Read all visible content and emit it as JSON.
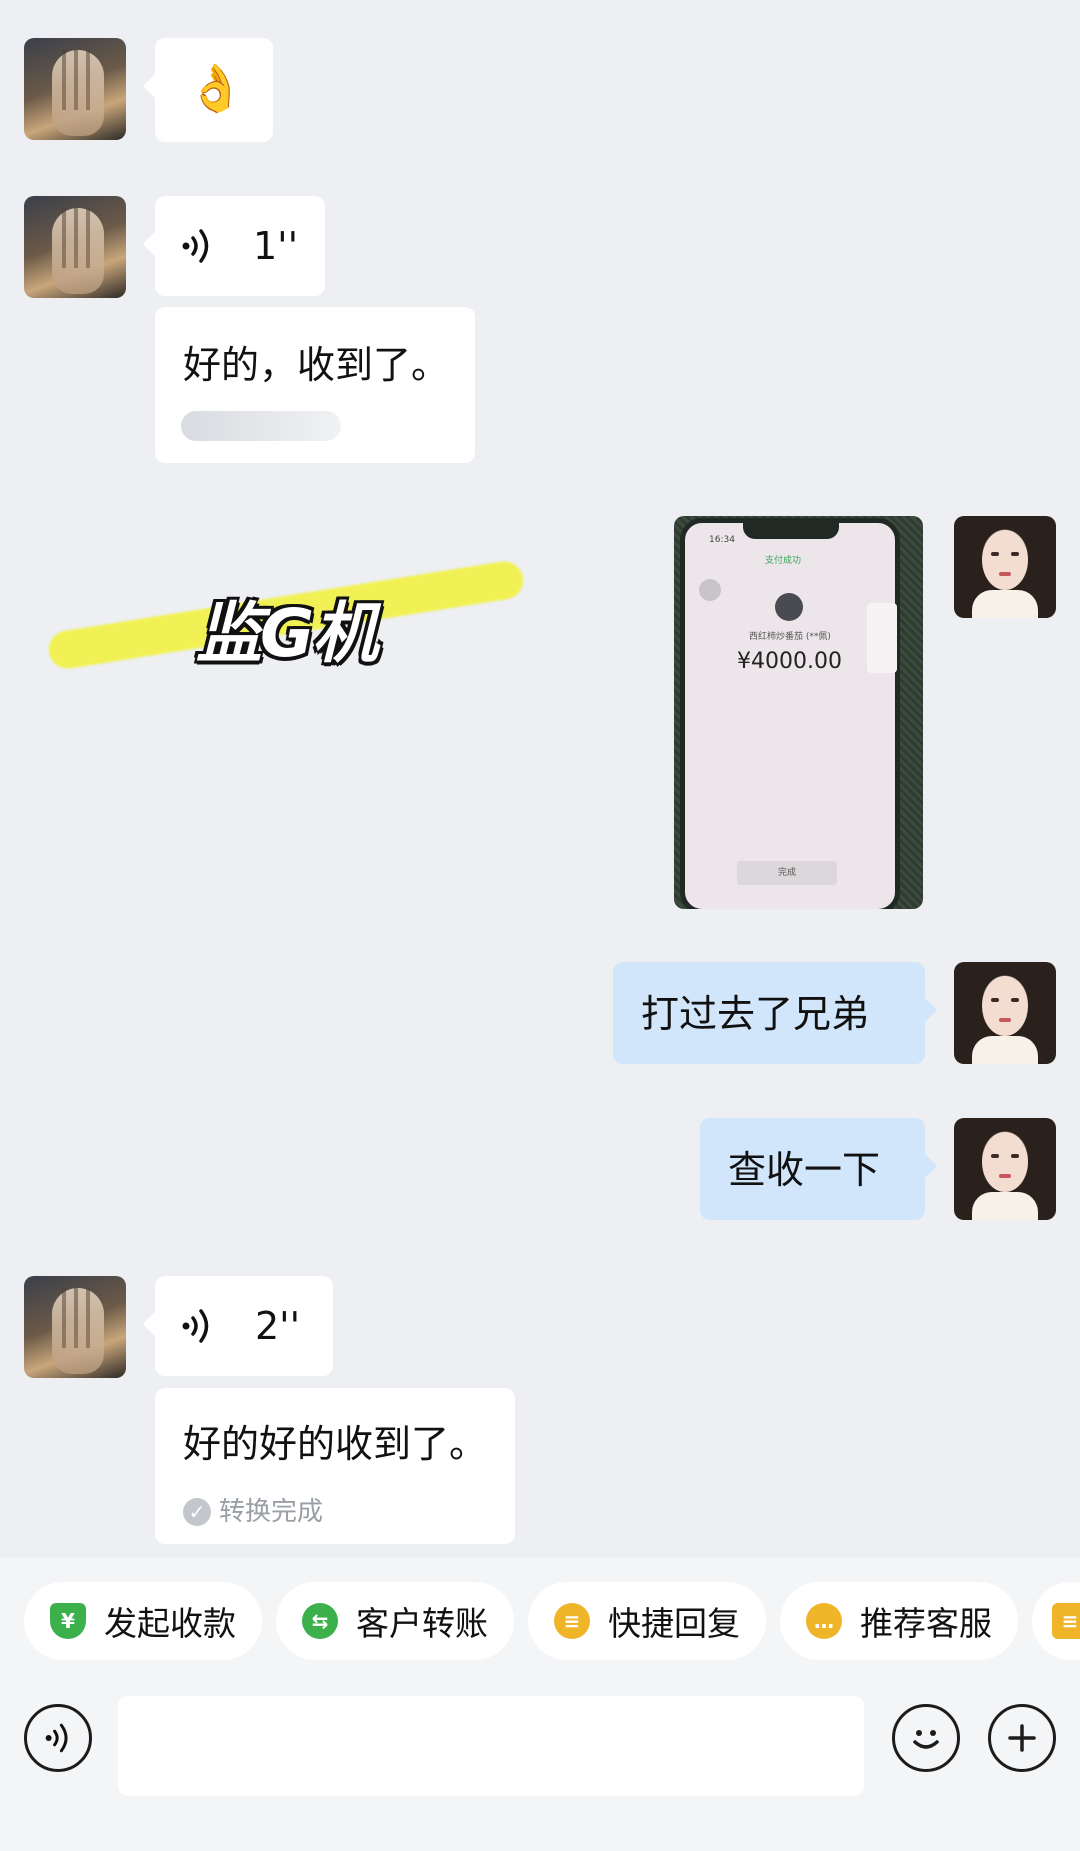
{
  "messages": {
    "m1": {
      "emoji": "👌"
    },
    "m2": {
      "duration": "1''"
    },
    "m3": {
      "text": "好的，收到了。"
    },
    "m4": {
      "clock": "16:34",
      "success": "支付成功",
      "payee": "西红柿炒番茄 (**佩)",
      "amount": "¥4000.00",
      "done_button": "完成"
    },
    "m5": {
      "text": "打过去了兄弟"
    },
    "m6": {
      "text": "查收一下"
    },
    "m7": {
      "duration": "2''"
    },
    "m8": {
      "text": "好的好的收到了。",
      "status": "转换完成"
    }
  },
  "watermark": {
    "text": "监G机"
  },
  "quick_actions": [
    {
      "label": "发起收款",
      "icon": "yuan-shield-icon",
      "color": "#3cb04a"
    },
    {
      "label": "客户转账",
      "icon": "transfer-icon",
      "color": "#3cb04a"
    },
    {
      "label": "快捷回复",
      "icon": "quick-reply-icon",
      "color": "#f0b429"
    },
    {
      "label": "推荐客服",
      "icon": "recommend-service-icon",
      "color": "#f0b429"
    }
  ],
  "input": {
    "placeholder": ""
  },
  "colors": {
    "background": "#edeff3",
    "bubble_self": "#d1e5fb",
    "bubble_peer": "#ffffff"
  }
}
